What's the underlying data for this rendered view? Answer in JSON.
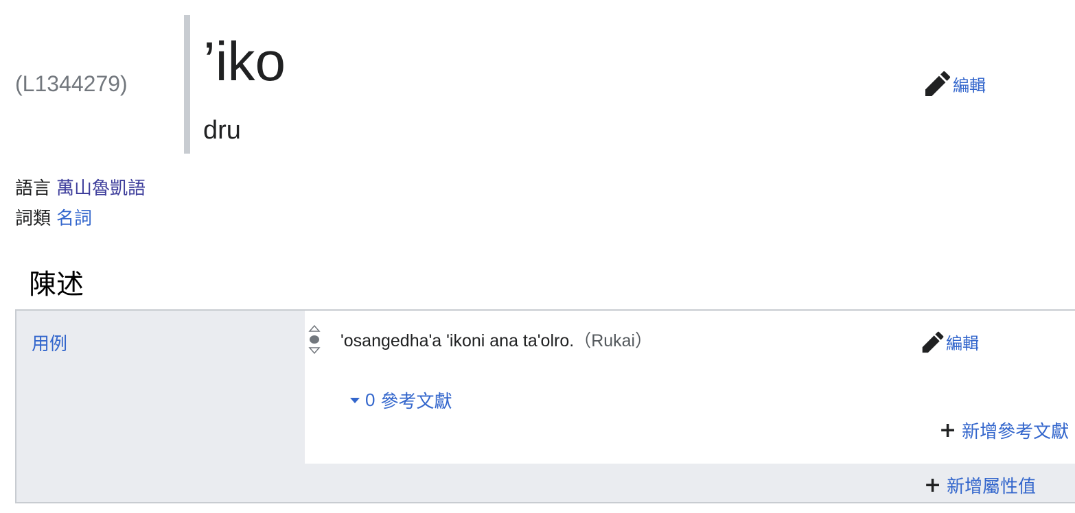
{
  "lexeme": {
    "id": "(L1344279)",
    "lemma": "’iko",
    "lemma_language_code": "dru",
    "edit_label": "編輯"
  },
  "meta": {
    "language_label": "語言",
    "language_value": "萬山魯凱語",
    "category_label": "詞類",
    "category_value": "名詞"
  },
  "section": {
    "heading": "陳述"
  },
  "statement_group": {
    "property": "用例",
    "statement": {
      "value": "'osangedha'a 'ikoni ana ta'olro.",
      "language": "（Rukai）",
      "edit_label": "編輯",
      "references_count": "0",
      "references_label": "參考文獻",
      "add_reference_label": "新增參考文獻"
    },
    "add_value_label": "新增屬性值"
  },
  "icons": {
    "edit": "pencil-icon",
    "rank": "rank-normal-icon",
    "add": "plus-icon",
    "toggle": "triangle-down-icon"
  },
  "colors": {
    "link": "#3366cc",
    "link_visited": "#3f3f9c",
    "muted": "#72777d",
    "border": "#c8ccd1",
    "group_bg": "#eaecf0"
  }
}
